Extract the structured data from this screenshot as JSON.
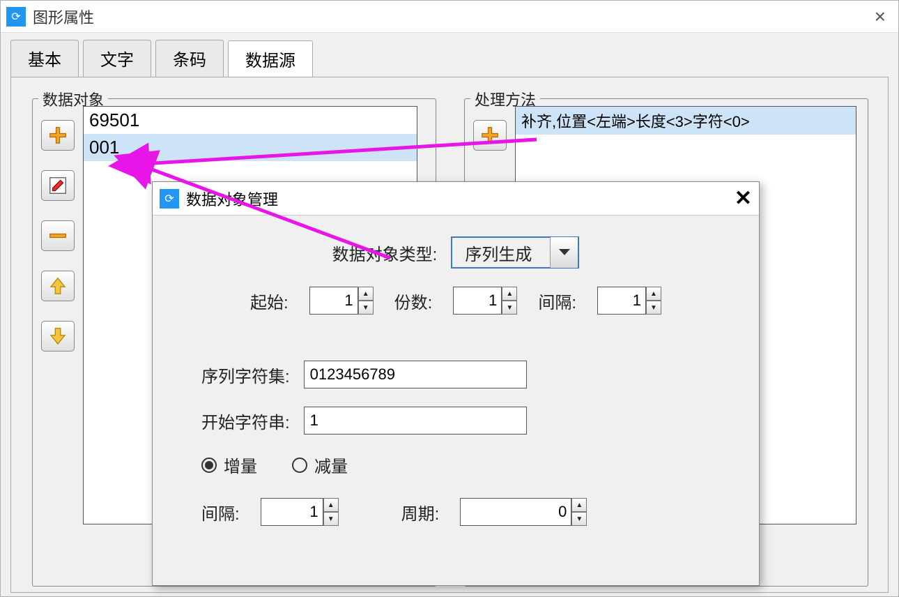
{
  "mainWindow": {
    "title": "图形属性",
    "tabs": [
      "基本",
      "文字",
      "条码",
      "数据源"
    ],
    "activeTab": 3
  },
  "dataObject": {
    "groupLabel": "数据对象",
    "items": [
      "69501",
      "001"
    ],
    "selectedIndex": 1
  },
  "procMethod": {
    "groupLabel": "处理方法",
    "items": [
      "补齐,位置<左端>长度<3>字符<0>"
    ]
  },
  "childDialog": {
    "title": "数据对象管理",
    "typeLabel": "数据对象类型:",
    "typeValue": "序列生成",
    "startLabel": "起始:",
    "startValue": "1",
    "copiesLabel": "份数:",
    "copiesValue": "1",
    "gapLabel": "间隔:",
    "gapValue": "1",
    "charsetLabel": "序列字符集:",
    "charsetValue": "0123456789",
    "startStrLabel": "开始字符串:",
    "startStrValue": "1",
    "radioInc": "增量",
    "radioDec": "减量",
    "radioChecked": "inc",
    "intervalLabel": "间隔:",
    "intervalValue": "1",
    "periodLabel": "周期:",
    "periodValue": "0"
  },
  "icons": {
    "appGlyph": "⟳"
  }
}
